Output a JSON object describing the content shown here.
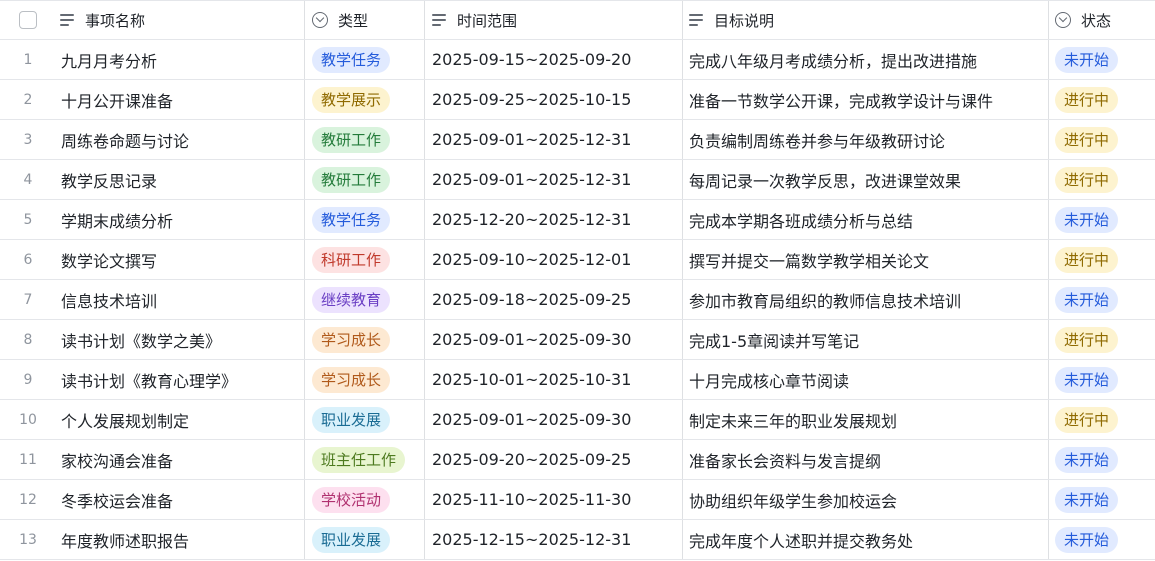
{
  "header": {
    "name": "事项名称",
    "type": "类型",
    "time": "时间范围",
    "goal": "目标说明",
    "status": "状态"
  },
  "colors": {
    "教学任务": {
      "bg": "#e1eaff",
      "fg": "#245bdb"
    },
    "教学展示": {
      "bg": "#fdf3cf",
      "fg": "#8f6a00"
    },
    "教研工作": {
      "bg": "#d9f3dd",
      "fg": "#237b3a"
    },
    "科研工作": {
      "bg": "#fde2e2",
      "fg": "#c0392b"
    },
    "继续教育": {
      "bg": "#ece2fe",
      "fg": "#6a3fc4"
    },
    "学习成长": {
      "bg": "#fde9d2",
      "fg": "#b0591a"
    },
    "职业发展": {
      "bg": "#d9f1fb",
      "fg": "#1a6c94"
    },
    "班主任工作": {
      "bg": "#e8f5d0",
      "fg": "#4d7a1f"
    },
    "学校活动": {
      "bg": "#fde0ef",
      "fg": "#b0306f"
    },
    "未开始": {
      "bg": "#e1eaff",
      "fg": "#245bdb"
    },
    "进行中": {
      "bg": "#fdf3cf",
      "fg": "#8f6a00"
    }
  },
  "rows": [
    {
      "num": "1",
      "name": "九月月考分析",
      "type": "教学任务",
      "time": "2025-09-15~2025-09-20",
      "goal": "完成八年级月考成绩分析，提出改进措施",
      "status": "未开始"
    },
    {
      "num": "2",
      "name": "十月公开课准备",
      "type": "教学展示",
      "time": "2025-09-25~2025-10-15",
      "goal": "准备一节数学公开课，完成教学设计与课件",
      "status": "进行中"
    },
    {
      "num": "3",
      "name": "周练卷命题与讨论",
      "type": "教研工作",
      "time": "2025-09-01~2025-12-31",
      "goal": "负责编制周练卷并参与年级教研讨论",
      "status": "进行中"
    },
    {
      "num": "4",
      "name": "教学反思记录",
      "type": "教研工作",
      "time": "2025-09-01~2025-12-31",
      "goal": "每周记录一次教学反思，改进课堂效果",
      "status": "进行中"
    },
    {
      "num": "5",
      "name": "学期末成绩分析",
      "type": "教学任务",
      "time": "2025-12-20~2025-12-31",
      "goal": "完成本学期各班成绩分析与总结",
      "status": "未开始"
    },
    {
      "num": "6",
      "name": "数学论文撰写",
      "type": "科研工作",
      "time": "2025-09-10~2025-12-01",
      "goal": "撰写并提交一篇数学教学相关论文",
      "status": "进行中"
    },
    {
      "num": "7",
      "name": "信息技术培训",
      "type": "继续教育",
      "time": "2025-09-18~2025-09-25",
      "goal": "参加市教育局组织的教师信息技术培训",
      "status": "未开始"
    },
    {
      "num": "8",
      "name": "读书计划《数学之美》",
      "type": "学习成长",
      "time": "2025-09-01~2025-09-30",
      "goal": "完成1-5章阅读并写笔记",
      "status": "进行中"
    },
    {
      "num": "9",
      "name": "读书计划《教育心理学》",
      "type": "学习成长",
      "time": "2025-10-01~2025-10-31",
      "goal": "十月完成核心章节阅读",
      "status": "未开始"
    },
    {
      "num": "10",
      "name": "个人发展规划制定",
      "type": "职业发展",
      "time": "2025-09-01~2025-09-30",
      "goal": "制定未来三年的职业发展规划",
      "status": "进行中"
    },
    {
      "num": "11",
      "name": "家校沟通会准备",
      "type": "班主任工作",
      "time": "2025-09-20~2025-09-25",
      "goal": "准备家长会资料与发言提纲",
      "status": "未开始"
    },
    {
      "num": "12",
      "name": "冬季校运会准备",
      "type": "学校活动",
      "time": "2025-11-10~2025-11-30",
      "goal": "协助组织年级学生参加校运会",
      "status": "未开始"
    },
    {
      "num": "13",
      "name": "年度教师述职报告",
      "type": "职业发展",
      "time": "2025-12-15~2025-12-31",
      "goal": "完成年度个人述职并提交教务处",
      "status": "未开始"
    }
  ]
}
